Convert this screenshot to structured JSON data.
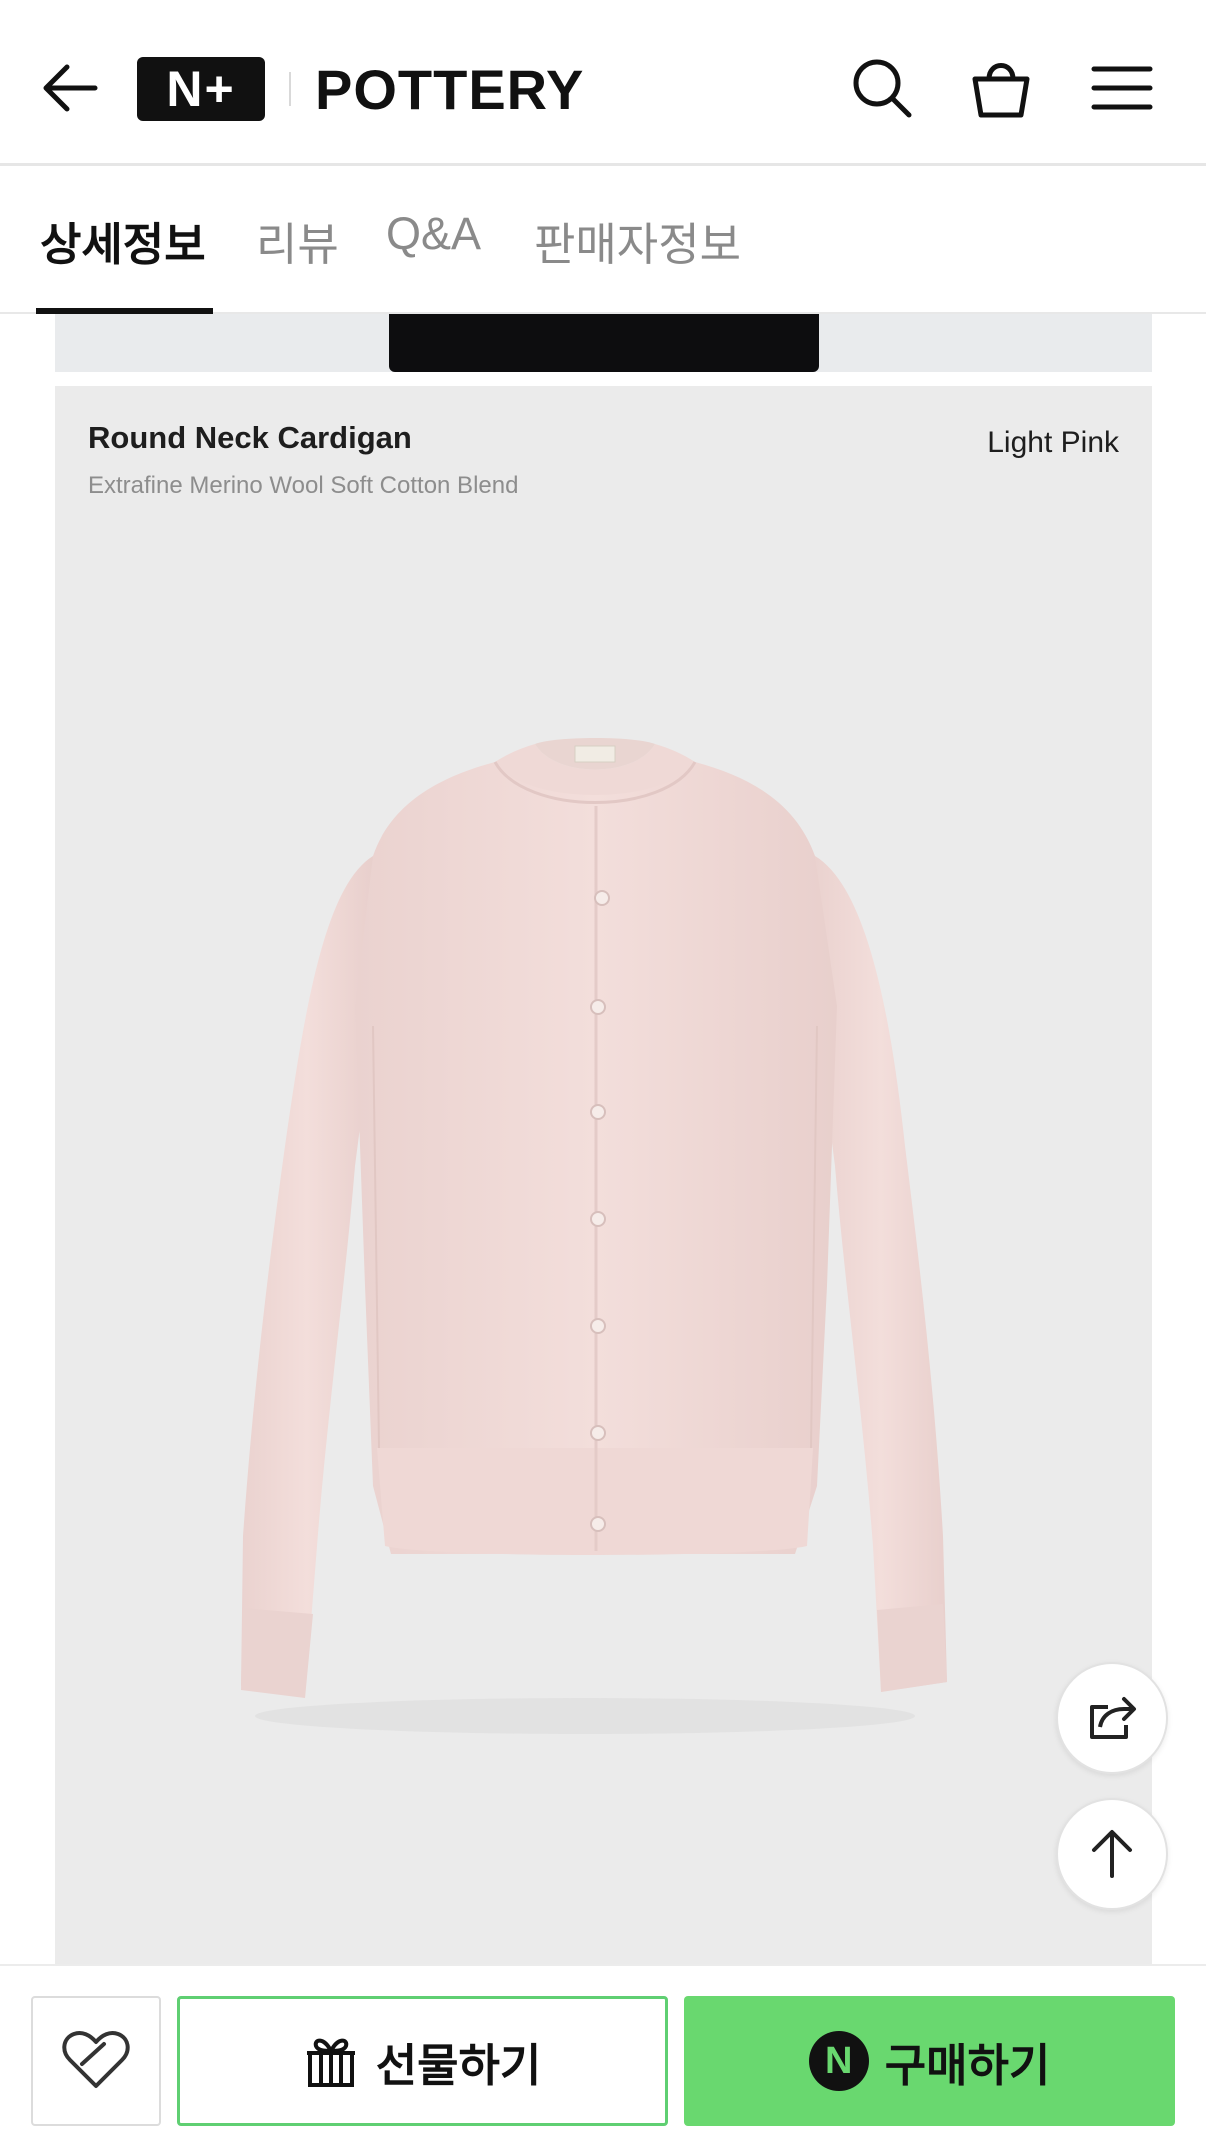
{
  "header": {
    "logo_mark": "N+",
    "brand_name": "POTTERY",
    "icons": [
      "back-arrow-icon",
      "search-icon",
      "shopping-bag-icon",
      "menu-icon"
    ]
  },
  "tabs": [
    {
      "label": "상세정보",
      "active": true
    },
    {
      "label": "리뷰",
      "active": false
    },
    {
      "label": "Q&A",
      "active": false
    },
    {
      "label": "판매자정보",
      "active": false
    }
  ],
  "product_card": {
    "title": "Round Neck Cardigan",
    "subtitle": "Extrafine Merino Wool Soft Cotton Blend",
    "color_name": "Light Pink"
  },
  "floating": {
    "icons": [
      "share-icon",
      "arrow-up-icon"
    ]
  },
  "bottom_bar": {
    "gift_label": "선물하기",
    "buy_label": "구매하기",
    "npay_badge": "N"
  },
  "colors": {
    "accent_green": "#69d86f",
    "gift_border": "#5fcf72",
    "garment_pink": "#f2dcd9",
    "photo_bg": "#ebebeb"
  }
}
